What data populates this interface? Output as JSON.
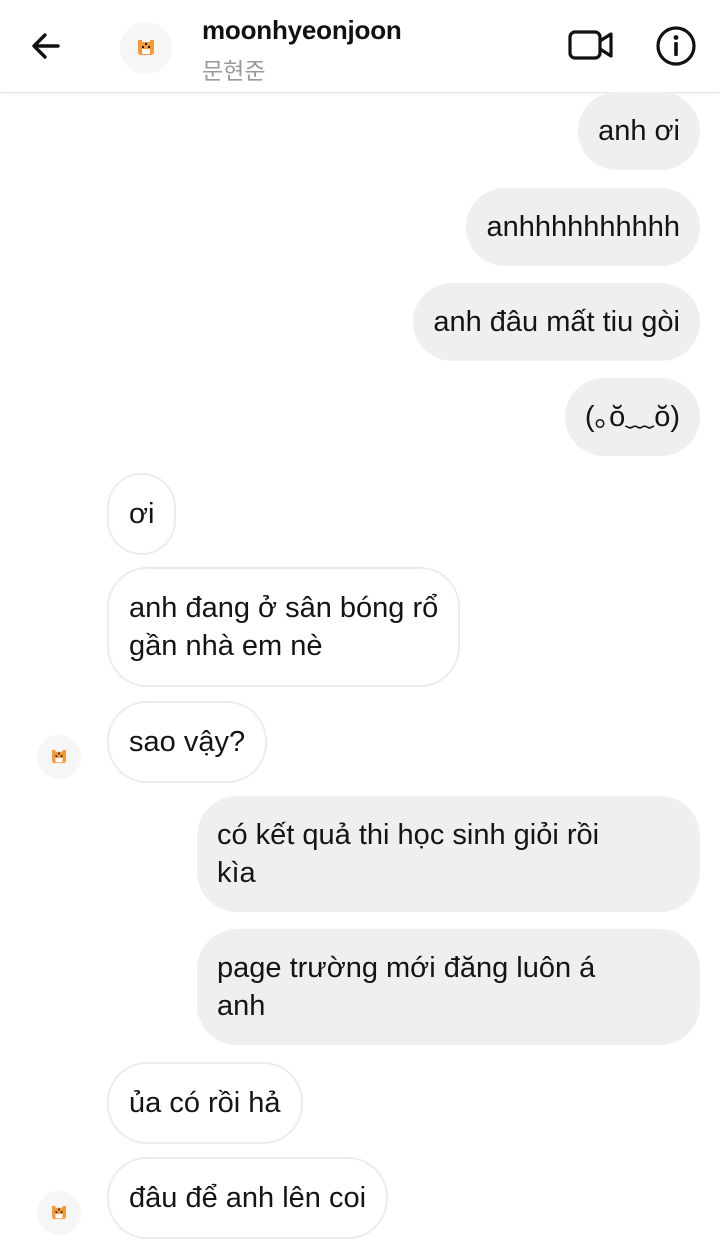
{
  "header": {
    "username": "moonhyeonjoon",
    "subtitle": "문현준",
    "back_icon": "arrow-left-icon",
    "video_icon": "video-camera-icon",
    "info_icon": "info-icon",
    "avatar_icon": "tiger-avatar-icon"
  },
  "messages": [
    {
      "direction": "outgoing",
      "text": "anh ơi"
    },
    {
      "direction": "outgoing",
      "text": "anhhhhhhhhhh"
    },
    {
      "direction": "outgoing",
      "text": "anh đâu mất tiu gòi"
    },
    {
      "direction": "outgoing",
      "text": "(｡ŏ﹏ŏ)"
    },
    {
      "direction": "incoming",
      "text": "ơi"
    },
    {
      "direction": "incoming",
      "text": "anh đang ở sân bóng rổ\ngần nhà em nè"
    },
    {
      "direction": "incoming",
      "text": "sao vậy?"
    },
    {
      "direction": "outgoing",
      "text": "có kết quả thi học sinh giỏi rồi\nkìa"
    },
    {
      "direction": "outgoing",
      "text": "page trường mới đăng luôn á\nanh"
    },
    {
      "direction": "incoming",
      "text": "ủa có rồi hả"
    },
    {
      "direction": "incoming",
      "text": "đâu để anh lên coi"
    }
  ],
  "colors": {
    "outgoing_bubble": "#efefef",
    "incoming_border": "#ececec",
    "subtitle": "#9a9a9a"
  }
}
